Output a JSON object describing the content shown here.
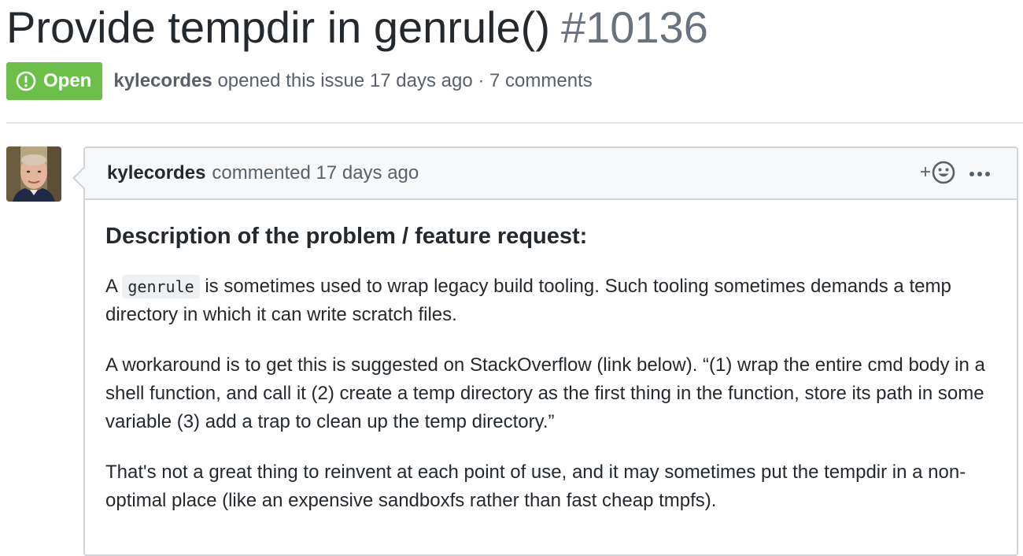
{
  "issue": {
    "title": "Provide tempdir in genrule()",
    "number": "#10136",
    "state": "Open",
    "author": "kylecordes",
    "opened_text": "opened this issue 17 days ago · 7 comments"
  },
  "comment": {
    "author": "kylecordes",
    "action": "commented 17 days ago",
    "reaction_plus": "+",
    "heading": "Description of the problem / feature request:",
    "p1_before": "A ",
    "p1_code": "genrule",
    "p1_after": " is sometimes used to wrap legacy build tooling. Such tooling sometimes demands a temp directory in which it can write scratch files.",
    "p2": "A workaround is to get this is suggested on StackOverflow (link below). “(1) wrap the entire cmd body in a shell function, and call it (2) create a temp directory as the first thing in the function, store its path in some variable (3) add a trap to clean up the temp directory.”",
    "p3": "That's not a great thing to reinvent at each point of use, and it may sometimes put the tempdir in a non-optimal place (like an expensive sandboxfs rather than fast cheap tmpfs)."
  },
  "icons": {
    "state_icon": "issue-opened-icon",
    "reaction_icon": "smiley-icon",
    "more_icon": "kebab-horizontal-icon"
  },
  "colors": {
    "open_green": "#6cc04a",
    "muted_text": "#586069",
    "border": "#d1d5da",
    "header_bg": "#f6f8fa"
  }
}
